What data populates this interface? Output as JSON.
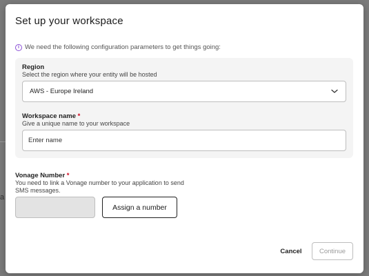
{
  "dialog": {
    "title": "Set up your workspace",
    "info_text": "We need the following configuration parameters to get things going:",
    "info_icon": "info-icon",
    "accent_color": "#8a4fd6"
  },
  "region": {
    "label": "Region",
    "help": "Select the region where your entity will be hosted",
    "selected": "AWS - Europe Ireland",
    "icon": "chevron-down-icon"
  },
  "workspace": {
    "label": "Workspace name",
    "required_mark": "*",
    "help": "Give a unique name to your workspace",
    "value": "",
    "placeholder": "Enter name"
  },
  "vonage": {
    "label": "Vonage Number",
    "required_mark": "*",
    "help": "You need to link a Vonage number to your application to send SMS messages.",
    "assign_label": "Assign a number"
  },
  "footer": {
    "cancel_label": "Cancel",
    "continue_label": "Continue"
  },
  "backdrop": {
    "partial_char": "a"
  }
}
